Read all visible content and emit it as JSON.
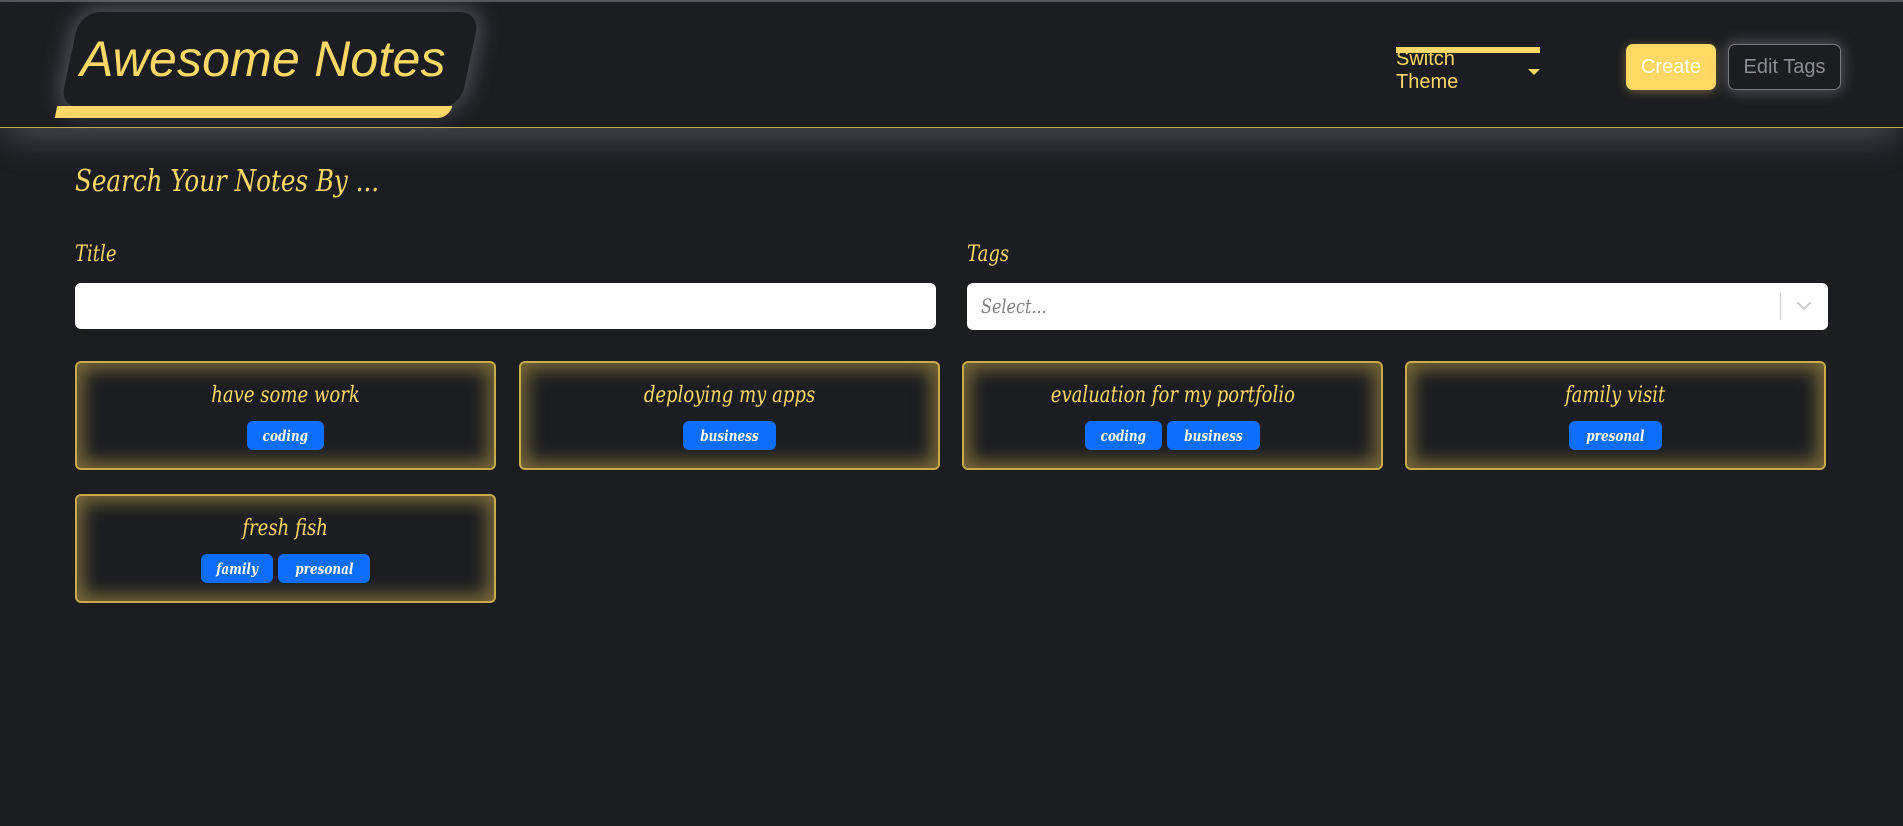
{
  "header": {
    "brand": "Awesome Notes",
    "theme_toggle": "Switch Theme",
    "create_label": "Create",
    "edit_tags_label": "Edit Tags"
  },
  "search": {
    "heading": "Search Your Notes By ...",
    "title_label": "Title",
    "title_value": "",
    "tags_label": "Tags",
    "tags_placeholder": "Select..."
  },
  "notes": [
    {
      "title": "have some work",
      "tags": [
        "coding"
      ]
    },
    {
      "title": "deploying my apps",
      "tags": [
        "business"
      ]
    },
    {
      "title": "evaluation for my portfolio",
      "tags": [
        "coding",
        "business"
      ]
    },
    {
      "title": "family visit",
      "tags": [
        "presonal"
      ]
    },
    {
      "title": "fresh fish",
      "tags": [
        "family",
        "presonal"
      ]
    }
  ],
  "colors": {
    "accent": "#ffd866",
    "background": "#1c1d21",
    "tag": "#0d6efd"
  }
}
